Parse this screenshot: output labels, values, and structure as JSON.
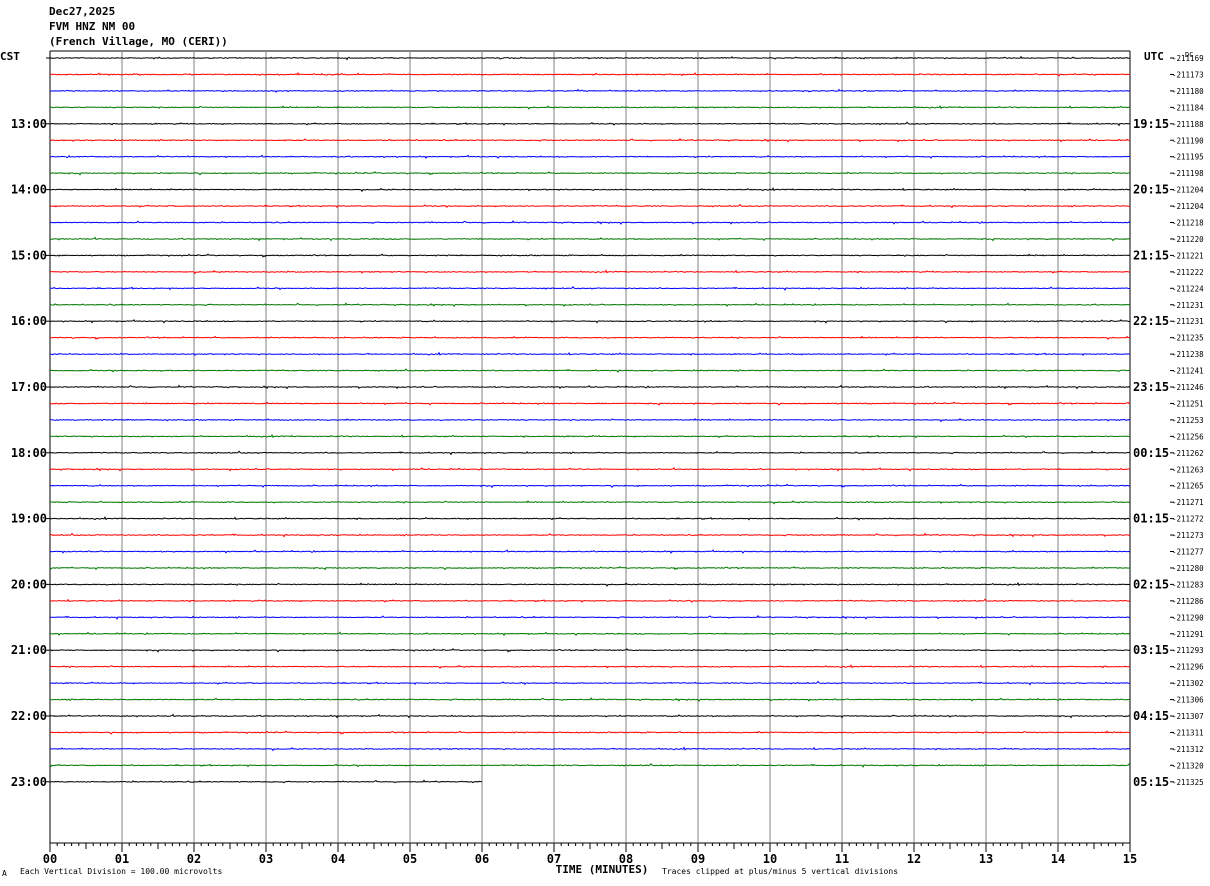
{
  "header": {
    "date": "Dec27,2025",
    "station": "FVM HNZ NM 00",
    "location": "(French Village, MO (CERI))"
  },
  "chart_data": {
    "type": "line",
    "left_timezone": "CST",
    "right_timezone": "UTC",
    "right_column_label": "DC",
    "xlabel": "TIME (MINUTES)",
    "xlim": [
      0,
      15
    ],
    "x_ticks": [
      "00",
      "01",
      "02",
      "03",
      "04",
      "05",
      "06",
      "07",
      "08",
      "09",
      "10",
      "11",
      "12",
      "13",
      "14",
      "15"
    ],
    "hour_labels_left": [
      "13:00",
      "14:00",
      "15:00",
      "16:00",
      "17:00",
      "18:00",
      "19:00",
      "20:00",
      "21:00",
      "22:00",
      "23:00"
    ],
    "hour_labels_right": [
      "19:15",
      "20:15",
      "21:15",
      "22:15",
      "23:15",
      "00:15",
      "01:15",
      "02:15",
      "03:15",
      "04:15",
      "05:15"
    ],
    "trace_colors": [
      "#000000",
      "#ff0000",
      "#0000ff",
      "#007800"
    ],
    "trace_count": 45,
    "last_trace_end_minute": 6,
    "dc_offsets": [
      "-211169",
      "-211173",
      "-211180",
      "-211184",
      "-211188",
      "-211190",
      "-211195",
      "-211198",
      "-211204",
      "-211204",
      "-211218",
      "-211220",
      "-211221",
      "-211222",
      "-211224",
      "-211231",
      "-211231",
      "-211235",
      "-211238",
      "-211241",
      "-211246",
      "-211251",
      "-211253",
      "-211256",
      "-211262",
      "-211263",
      "-211265",
      "-211271",
      "-211272",
      "-211273",
      "-211277",
      "-211280",
      "-211283",
      "-211286",
      "-211290",
      "-211291",
      "-211293",
      "-211296",
      "-211302",
      "-211306",
      "-211307",
      "-211311",
      "-211312",
      "-211320",
      "-211325"
    ],
    "vertical_division": "Each Vertical Division = 100.00 microvolts",
    "clip_note": "Traces clipped at plus/minus 5 vertical divisions"
  },
  "footer": {
    "mark": "A"
  }
}
